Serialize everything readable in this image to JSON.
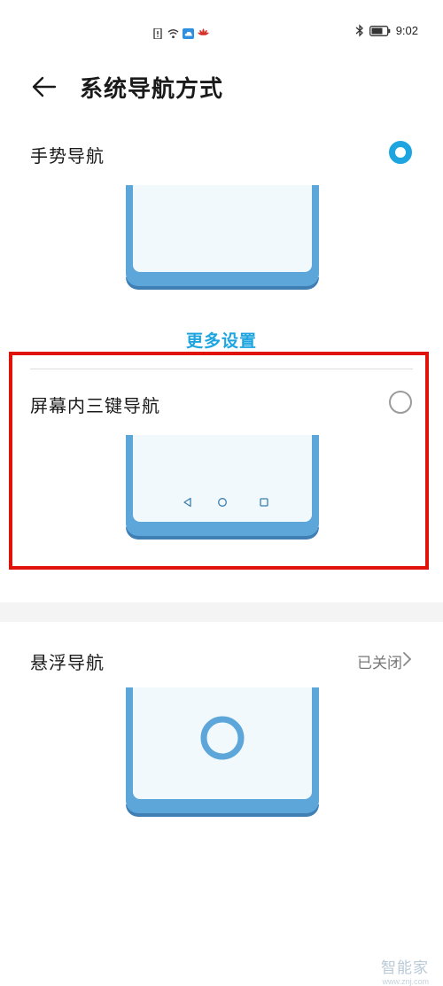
{
  "status_bar": {
    "time": "9:02",
    "icons": [
      "notification-icon",
      "wifi-icon",
      "cloud-icon",
      "huawei-icon",
      "bluetooth-icon",
      "battery-icon"
    ]
  },
  "header": {
    "back_icon": "back-arrow-icon",
    "title": "系统导航方式"
  },
  "options": [
    {
      "label": "手势导航",
      "selected": true
    },
    {
      "label": "屏幕内三键导航",
      "selected": false,
      "keys": [
        "back-triangle-icon",
        "home-circle-icon",
        "recent-square-icon"
      ]
    },
    {
      "label": "悬浮导航",
      "status": "已关闭"
    }
  ],
  "more_settings": "更多设置",
  "colors": {
    "accent": "#1ea5e0",
    "phone_body": "#5da6d9",
    "phone_screen": "#f2f9fd",
    "highlight_box": "#e0130b"
  },
  "watermark": {
    "main": "智能家",
    "sub": "www.znj.com"
  }
}
